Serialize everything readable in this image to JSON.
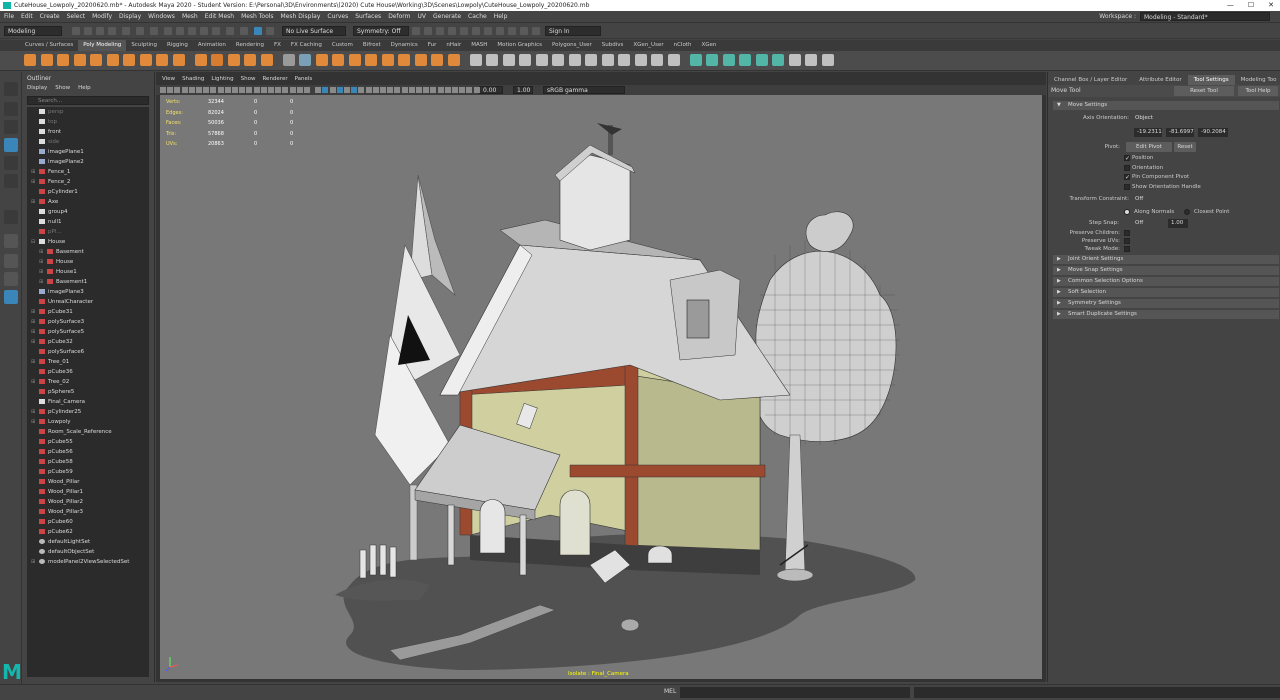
{
  "title_bar": {
    "text": "CuteHouse_Lowpoly_20200620.mb* - Autodesk Maya 2020 - Student Version: E:\\Personal\\3D\\Environments\\(2020) Cute House\\Working\\3D\\Scenes\\Lowpoly\\CuteHouse_Lowpoly_20200620.mb",
    "minimize": "—",
    "maximize": "☐",
    "close": "✕"
  },
  "menu": [
    "File",
    "Edit",
    "Create",
    "Select",
    "Modify",
    "Display",
    "Windows",
    "Mesh",
    "Edit Mesh",
    "Mesh Tools",
    "Mesh Display",
    "Curves",
    "Surfaces",
    "Deform",
    "UV",
    "Generate",
    "Cache",
    "Help"
  ],
  "workspace": {
    "label": "Workspace :",
    "value": "Modeling - Standard*"
  },
  "status_line": {
    "mode": "Modeling",
    "live_surface": "No Live Surface",
    "symmetry": "Symmetry: Off",
    "sign_in": "Sign In"
  },
  "shelf_tabs": [
    "Curves / Surfaces",
    "Poly Modeling",
    "Sculpting",
    "Rigging",
    "Animation",
    "Rendering",
    "FX",
    "FX Caching",
    "Custom",
    "Bifrost",
    "Dynamics",
    "Fur",
    "nHair",
    "MASH",
    "Motion Graphics",
    "Polygons_User",
    "Subdivs",
    "XGen_User",
    "nCloth",
    "XGen"
  ],
  "shelf_active_index": 1,
  "outliner": {
    "title": "Outliner",
    "menu": [
      "Display",
      "Show",
      "Help"
    ],
    "search_placeholder": "Search...",
    "items": [
      {
        "label": "persp",
        "type": "cam",
        "dim": true,
        "exp": ""
      },
      {
        "label": "top",
        "type": "cam",
        "dim": true,
        "exp": ""
      },
      {
        "label": "front",
        "type": "cam",
        "dim": false,
        "exp": ""
      },
      {
        "label": "side",
        "type": "cam",
        "dim": true,
        "exp": ""
      },
      {
        "label": "imagePlane1",
        "type": "img",
        "dim": false,
        "exp": ""
      },
      {
        "label": "imagePlane2",
        "type": "img",
        "dim": false,
        "exp": ""
      },
      {
        "label": "Fence_1",
        "type": "mesh",
        "dim": false,
        "exp": "⊞"
      },
      {
        "label": "Fence_2",
        "type": "mesh",
        "dim": false,
        "exp": "⊞"
      },
      {
        "label": "pCylinder1",
        "type": "mesh",
        "dim": false,
        "exp": ""
      },
      {
        "label": "Axe",
        "type": "mesh",
        "dim": false,
        "exp": "⊞"
      },
      {
        "label": "group4",
        "type": "grp",
        "dim": false,
        "exp": ""
      },
      {
        "label": "null1",
        "type": "grp",
        "dim": false,
        "exp": ""
      },
      {
        "label": "pPl...",
        "type": "mesh",
        "dim": true,
        "exp": ""
      },
      {
        "label": "House",
        "type": "grp",
        "dim": false,
        "exp": "⊟"
      },
      {
        "label": "Basement",
        "type": "mesh",
        "dim": false,
        "exp": "⊞",
        "indent": 1
      },
      {
        "label": "House",
        "type": "mesh",
        "dim": false,
        "exp": "⊞",
        "indent": 1
      },
      {
        "label": "House1",
        "type": "mesh",
        "dim": false,
        "exp": "⊞",
        "indent": 1
      },
      {
        "label": "Basement1",
        "type": "mesh",
        "dim": false,
        "exp": "⊞",
        "indent": 1
      },
      {
        "label": "imagePlane3",
        "type": "img",
        "dim": false,
        "exp": ""
      },
      {
        "label": "UnrealCharacter",
        "type": "mesh",
        "dim": false,
        "exp": ""
      },
      {
        "label": "pCube31",
        "type": "mesh",
        "dim": false,
        "exp": "⊞"
      },
      {
        "label": "polySurface3",
        "type": "mesh",
        "dim": false,
        "exp": "⊞"
      },
      {
        "label": "polySurface5",
        "type": "mesh",
        "dim": false,
        "exp": "⊞"
      },
      {
        "label": "pCube32",
        "type": "mesh",
        "dim": false,
        "exp": "⊞"
      },
      {
        "label": "polySurface6",
        "type": "mesh",
        "dim": false,
        "exp": ""
      },
      {
        "label": "Tree_01",
        "type": "mesh",
        "dim": false,
        "exp": "⊞"
      },
      {
        "label": "pCube36",
        "type": "mesh",
        "dim": false,
        "exp": ""
      },
      {
        "label": "Tree_02",
        "type": "mesh",
        "dim": false,
        "exp": "⊞"
      },
      {
        "label": "pSphere5",
        "type": "mesh",
        "dim": false,
        "exp": ""
      },
      {
        "label": "Final_Camera",
        "type": "cam",
        "dim": false,
        "exp": ""
      },
      {
        "label": "pCylinder25",
        "type": "mesh",
        "dim": false,
        "exp": "⊞"
      },
      {
        "label": "Lowpoly",
        "type": "mesh",
        "dim": false,
        "exp": "⊞"
      },
      {
        "label": "Room_Scale_Reference",
        "type": "mesh",
        "dim": false,
        "exp": ""
      },
      {
        "label": "pCube55",
        "type": "mesh",
        "dim": false,
        "exp": ""
      },
      {
        "label": "pCube56",
        "type": "mesh",
        "dim": false,
        "exp": ""
      },
      {
        "label": "pCube58",
        "type": "mesh",
        "dim": false,
        "exp": ""
      },
      {
        "label": "pCube59",
        "type": "mesh",
        "dim": false,
        "exp": ""
      },
      {
        "label": "Wood_Pillar",
        "type": "mesh",
        "dim": false,
        "exp": ""
      },
      {
        "label": "Wood_Pillar1",
        "type": "mesh",
        "dim": false,
        "exp": ""
      },
      {
        "label": "Wood_Pillar2",
        "type": "mesh",
        "dim": false,
        "exp": ""
      },
      {
        "label": "Wood_Pillar3",
        "type": "mesh",
        "dim": false,
        "exp": ""
      },
      {
        "label": "pCube60",
        "type": "mesh",
        "dim": false,
        "exp": ""
      },
      {
        "label": "pCube62",
        "type": "mesh",
        "dim": false,
        "exp": ""
      },
      {
        "label": "defaultLightSet",
        "type": "set",
        "dim": false,
        "exp": ""
      },
      {
        "label": "defaultObjectSet",
        "type": "set",
        "dim": false,
        "exp": ""
      },
      {
        "label": "modelPanel2ViewSelectedSet",
        "type": "set",
        "dim": false,
        "exp": "⊞"
      }
    ]
  },
  "viewport": {
    "menu": [
      "View",
      "Shading",
      "Lighting",
      "Show",
      "Renderer",
      "Panels"
    ],
    "exposure": "0.00",
    "gamma": "1.00",
    "color_space": "sRGB gamma",
    "hud": [
      {
        "label": "Verts:",
        "a": "32344",
        "b": "0",
        "c": "0"
      },
      {
        "label": "Edges:",
        "a": "82024",
        "b": "0",
        "c": "0"
      },
      {
        "label": "Faces:",
        "a": "50036",
        "b": "0",
        "c": "0"
      },
      {
        "label": "Tris:",
        "a": "57868",
        "b": "0",
        "c": "0"
      },
      {
        "label": "UVs:",
        "a": "20863",
        "b": "0",
        "c": "0"
      }
    ],
    "camera_label": "Isolate : Final_Camera"
  },
  "right_panel": {
    "tabs": [
      "Channel Box / Layer Editor",
      "Attribute Editor",
      "Tool Settings",
      "Modeling Too"
    ],
    "active_tab_index": 2,
    "tool_name": "Move Tool",
    "reset_tool": "Reset Tool",
    "tool_help": "Tool Help",
    "move_settings": "Move Settings",
    "axis_orientation_label": "Axis Orientation:",
    "axis_orientation_value": "Object",
    "axis_values": [
      "-19.2311",
      "-81.6997",
      "-90.2084"
    ],
    "pivot_label": "Pivot:",
    "edit_pivot": "Edit Pivot",
    "reset": "Reset",
    "pivot_options": [
      {
        "label": "Position",
        "checked": true
      },
      {
        "label": "Orientation",
        "checked": false
      },
      {
        "label": "Pin Component Pivot",
        "checked": true
      },
      {
        "label": "Show Orientation Handle",
        "checked": false
      }
    ],
    "transform_constraint_label": "Transform Constraint:",
    "transform_constraint_value": "Off",
    "along_normals": "Along Normals",
    "closest_point": "Closest Point",
    "step_snap_label": "Step Snap:",
    "step_snap_value": "Off",
    "step_snap_amount": "1.00",
    "preserve_children": "Preserve Children:",
    "preserve_uvs": "Preserve UVs:",
    "tweak_mode": "Tweak Mode:",
    "sections": [
      "Joint Orient Settings",
      "Move Snap Settings",
      "Common Selection Options",
      "Soft Selection",
      "Symmetry Settings",
      "Smart Duplicate Settings"
    ]
  },
  "command_line": {
    "label": "MEL"
  },
  "colors": {
    "accent": "#11b5a8",
    "house_wall": "#cfcf9f",
    "house_trim": "#9b4a2f",
    "viewport_bg": "#787878"
  }
}
